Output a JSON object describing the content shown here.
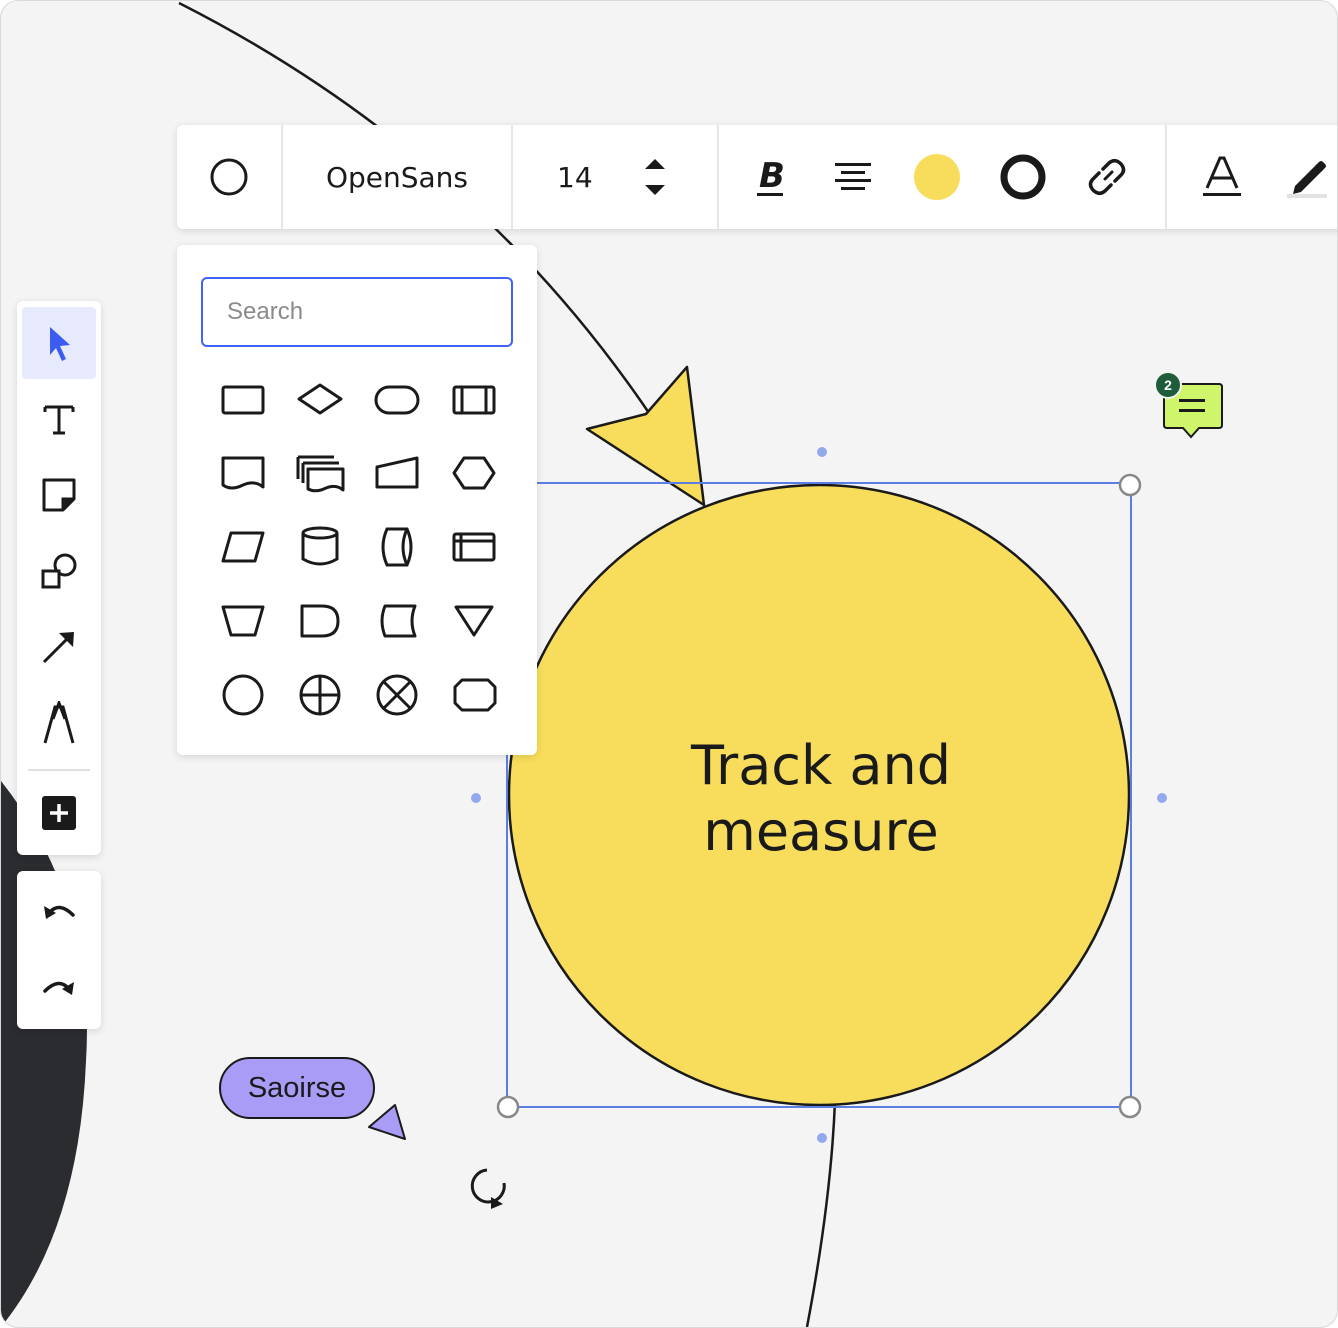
{
  "toolbar": {
    "shape_type": "circle-icon",
    "font_name": "OpenSans",
    "font_size": "14",
    "fill_color": "#f8dd5c",
    "icons": [
      "bold-icon",
      "align-center-icon",
      "fill-color-swatch",
      "border-style-icon",
      "link-icon",
      "text-color-icon",
      "highlighter-icon"
    ]
  },
  "left_toolbar": {
    "tools": [
      "select-tool",
      "text-tool",
      "sticky-note-tool",
      "shapes-tool",
      "connector-tool",
      "pen-tool",
      "add-more-tool"
    ],
    "active_tool": "select-tool",
    "history": [
      "undo",
      "redo"
    ]
  },
  "shape_panel": {
    "search_placeholder": "Search",
    "search_value": "",
    "shapes": [
      "rectangle",
      "diamond",
      "rounded-rectangle",
      "predefined-process",
      "document",
      "multiple-documents",
      "manual-input",
      "hexagon",
      "parallelogram",
      "cylinder",
      "horizontal-cylinder",
      "internal-storage",
      "trapezoid",
      "delay",
      "stored-data",
      "triangle-down",
      "circle",
      "circle-cross",
      "circle-x",
      "octagon-rounded"
    ]
  },
  "canvas": {
    "selected_shape_text": "Track and measure",
    "selected_shape_fill": "#f8dd5c",
    "selection_color": "#5b7ee5",
    "collaborator_name": "Saoirse",
    "collaborator_color": "#a89cf7",
    "comment_count": "2",
    "comment_color": "#cff56b"
  }
}
